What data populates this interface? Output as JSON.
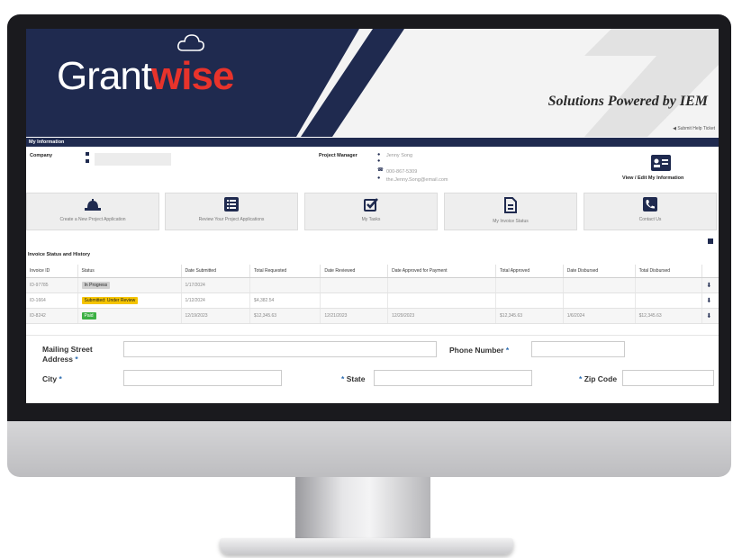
{
  "colors": {
    "navy": "#1f2a4f",
    "red": "#e8332b",
    "progress": "#d0d0d0",
    "review": "#f5c400",
    "paid": "#3cb043"
  },
  "header": {
    "logo_part1": "Grant",
    "logo_part2": "wise",
    "tagline": "Solutions Powered by IEM",
    "help_link": "Submit Help Ticket"
  },
  "my_info": {
    "section_title": "My Information",
    "company_label": "Company",
    "pm_label": "Project Manager",
    "pm_name": "Jenny Song",
    "pm_phone": "000-867-5309",
    "pm_email": "the.Jenny.Song@email.com",
    "view_edit_label": "View / Edit My Information"
  },
  "tiles": [
    {
      "label": "Create a New Project Application",
      "icon": "hat-icon"
    },
    {
      "label": "Review Your Project Applications",
      "icon": "list-icon"
    },
    {
      "label": "My Tasks",
      "icon": "checkbox-icon"
    },
    {
      "label": "My Invoice Status",
      "icon": "document-icon"
    },
    {
      "label": "Contact Us",
      "icon": "phone-icon"
    }
  ],
  "invoice": {
    "section_title": "Invoice Status and History",
    "columns": [
      "Invoice ID",
      "Status",
      "Date Submitted",
      "Total Requested",
      "Date Reviewed",
      "Date Approved for Payment",
      "Total Approved",
      "Date Disbursed",
      "Total Disbursed"
    ],
    "rows": [
      {
        "id": "ID-97785",
        "status": "In Progress",
        "submitted": "1/17/2024",
        "requested": "",
        "reviewed": "",
        "approved_date": "",
        "approved": "",
        "disbursed_date": "",
        "disbursed": ""
      },
      {
        "id": "ID-1664",
        "status": "Submitted: Under Review",
        "submitted": "1/12/2024",
        "requested": "$4,382.54",
        "reviewed": "",
        "approved_date": "",
        "approved": "",
        "disbursed_date": "",
        "disbursed": ""
      },
      {
        "id": "ID-8242",
        "status": "Paid",
        "submitted": "12/19/2023",
        "requested": "$12,345.63",
        "reviewed": "12/21/2023",
        "approved_date": "12/29/2023",
        "approved": "$12,345.63",
        "disbursed_date": "1/6/2024",
        "disbursed": "$12,345.63"
      }
    ]
  },
  "form": {
    "mailing_street": "Mailing Street Address",
    "phone": "Phone Number",
    "city": "City",
    "state": "State",
    "zip": "Zip Code",
    "required_mark": "*"
  }
}
